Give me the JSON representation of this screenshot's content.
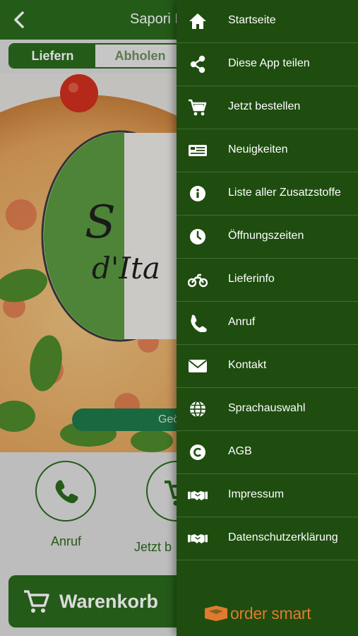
{
  "header": {
    "title": "Sapori D"
  },
  "order_mode": {
    "options": [
      "Liefern",
      "Abholen"
    ],
    "selected": "Liefern"
  },
  "hero": {
    "logo_text": "Sapori d'Italia",
    "status_text": "Geö"
  },
  "actions": [
    {
      "label": "Anruf",
      "icon": "phone-icon"
    },
    {
      "label": "Jetzt b",
      "icon": "cart-icon"
    }
  ],
  "cart": {
    "label": "Warenkorb",
    "icon": "cart-icon"
  },
  "colors": {
    "primary": "#2a6a1d",
    "drawer": "#1e4d0f",
    "brand": "#e07a2e"
  },
  "menu": {
    "items": [
      {
        "label": "Startseite",
        "icon": "home-icon"
      },
      {
        "label": "Diese App teilen",
        "icon": "share-icon"
      },
      {
        "label": "Jetzt bestellen",
        "icon": "cart-icon"
      },
      {
        "label": "Neuigkeiten",
        "icon": "news-icon"
      },
      {
        "label": "Liste aller Zusatzstoffe",
        "icon": "info-icon"
      },
      {
        "label": "Öffnungszeiten",
        "icon": "clock-icon"
      },
      {
        "label": "Lieferinfo",
        "icon": "motorcycle-icon"
      },
      {
        "label": "Anruf",
        "icon": "phone-icon"
      },
      {
        "label": "Kontakt",
        "icon": "envelope-icon"
      },
      {
        "label": "Sprachauswahl",
        "icon": "globe-icon"
      },
      {
        "label": "AGB",
        "icon": "copyright-icon"
      },
      {
        "label": "Impressum",
        "icon": "handshake-icon"
      },
      {
        "label": "Datenschutzerklärung",
        "icon": "handshake-icon"
      }
    ]
  },
  "brand": {
    "text": "order smart"
  }
}
